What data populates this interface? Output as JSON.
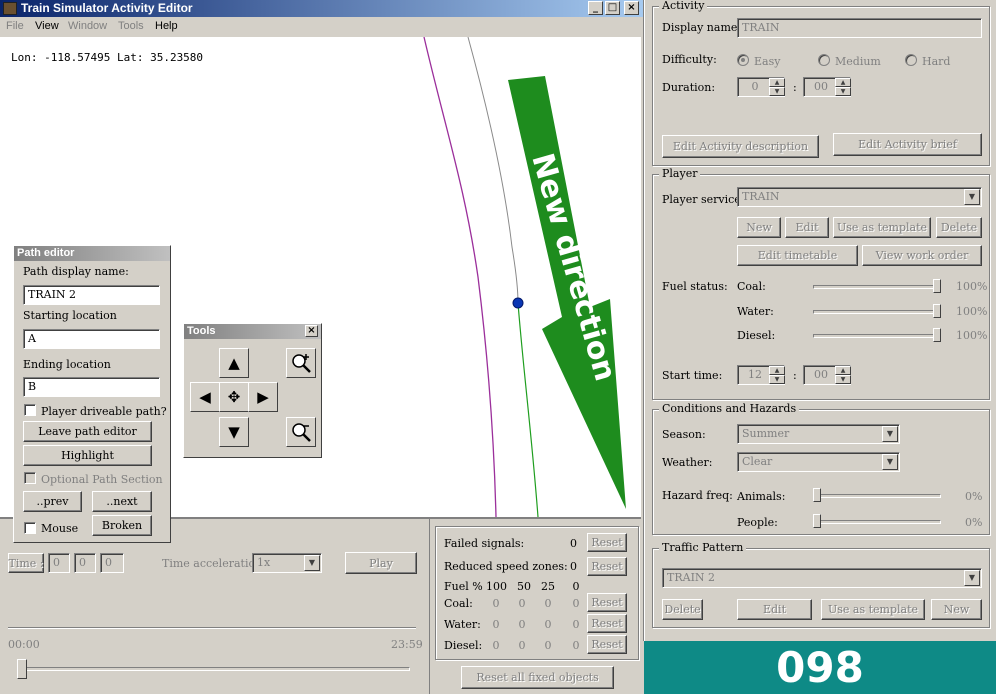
{
  "window": {
    "title": "Train Simulator Activity Editor",
    "min": "_",
    "max": "□",
    "close": "×"
  },
  "menu": [
    {
      "label": "File",
      "enabled": false
    },
    {
      "label": "View",
      "enabled": true
    },
    {
      "label": "Window",
      "enabled": false
    },
    {
      "label": "Tools",
      "enabled": false
    },
    {
      "label": "Help",
      "enabled": true
    }
  ],
  "map": {
    "coords": "Lon: -118.57495 Lat: 35.23580",
    "annotation": "New direction",
    "colors": {
      "track_purple": "#9b2f9b",
      "track_gray": "#8a8a8a",
      "track_green": "#1f9e1f",
      "arrow": "#1e8c1e",
      "node": "#0a37b4"
    }
  },
  "path_editor": {
    "title": "Path editor",
    "display_name_label": "Path display name:",
    "display_name": "TRAIN 2",
    "start_label": "Starting location",
    "start": "A",
    "end_label": "Ending location",
    "end": "B",
    "driveable_label": "Player driveable path?",
    "leave_btn": "Leave path editor",
    "highlight_btn": "Highlight",
    "optional_label": "Optional Path Section",
    "prev_btn": "..prev",
    "next_btn": "..next",
    "mouse_label": "Mouse",
    "broken_btn": "Broken"
  },
  "tools": {
    "title": "Tools",
    "close": "×",
    "icons": [
      "zoom-in-icon",
      "arrow-up-icon",
      "arrow-left-icon",
      "move-center-icon",
      "arrow-right-icon",
      "arrow-down-icon",
      "zoom-out-icon"
    ]
  },
  "playback": {
    "time_btn": "Time :",
    "time_h": "0",
    "time_m": "0",
    "time_s": "0",
    "accel_label": "Time acceleration",
    "accel_value": "1x",
    "play_btn": "Play",
    "start": "00:00",
    "end": "23:59"
  },
  "failures": {
    "failed_signals_label": "Failed signals:",
    "failed_signals": "0",
    "reduced_label": "Reduced speed zones:",
    "reduced": "0",
    "reset": "Reset",
    "fuel_label": "Fuel %",
    "fuel_cols": [
      "100",
      "50",
      "25",
      "0"
    ],
    "rows": [
      {
        "label": "Coal:",
        "values": [
          "0",
          "0",
          "0",
          "0"
        ]
      },
      {
        "label": "Water:",
        "values": [
          "0",
          "0",
          "0",
          "0"
        ]
      },
      {
        "label": "Diesel:",
        "values": [
          "0",
          "0",
          "0",
          "0"
        ]
      }
    ],
    "reset_all": "Reset all fixed objects"
  },
  "activity": {
    "title": "Activity",
    "display_name_label": "Display name:",
    "display_name": "TRAIN",
    "difficulty_label": "Difficulty:",
    "difficulty": [
      "Easy",
      "Medium",
      "Hard"
    ],
    "selected_difficulty": "Easy",
    "duration_label": "Duration:",
    "duration_h": "0",
    "duration_m": "00",
    "colon": ":",
    "edit_desc_btn": "Edit Activity description",
    "edit_brief_btn": "Edit Activity brief"
  },
  "player": {
    "title": "Player",
    "service_label": "Player service:",
    "service": "TRAIN",
    "new_btn": "New",
    "edit_btn": "Edit",
    "template_btn": "Use as template",
    "delete_btn": "Delete",
    "timetable_btn": "Edit timetable",
    "workorder_btn": "View work order",
    "fuel_label": "Fuel status:",
    "coal_label": "Coal:",
    "coal": "100%",
    "water_label": "Water:",
    "water": "100%",
    "diesel_label": "Diesel:",
    "diesel": "100%",
    "fuel_levels": {
      "coal": 1.0,
      "water": 1.0,
      "diesel": 1.0
    },
    "start_time_label": "Start time:",
    "start_h": "12",
    "start_m": "00"
  },
  "conditions": {
    "title": "Conditions and Hazards",
    "season_label": "Season:",
    "season": "Summer",
    "weather_label": "Weather:",
    "weather": "Clear",
    "hazard_label": "Hazard freq:",
    "animals_label": "Animals:",
    "animals": "0%",
    "people_label": "People:",
    "people": "0%",
    "levels": {
      "animals": 0,
      "people": 0
    }
  },
  "traffic": {
    "title": "Traffic Pattern",
    "value": "TRAIN 2",
    "delete_btn": "Delete",
    "edit_btn": "Edit",
    "template_btn": "Use as template",
    "new_btn": "New"
  },
  "badge": "098"
}
